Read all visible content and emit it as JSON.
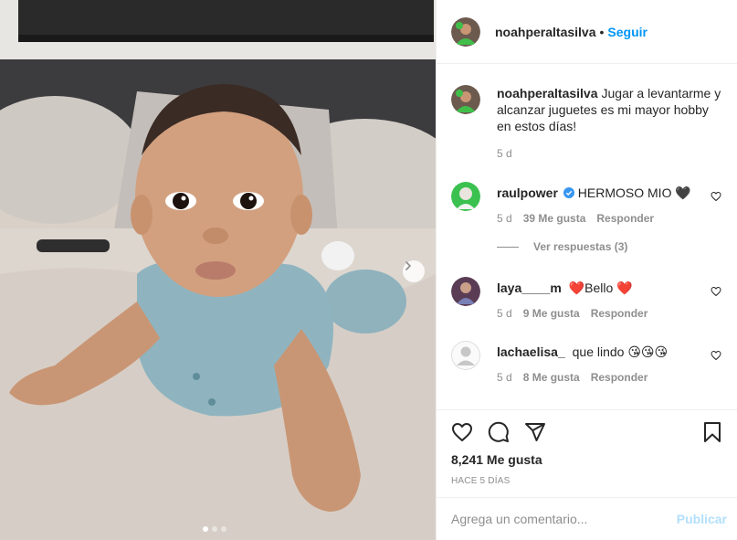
{
  "post": {
    "image_alt": "Baby lying on bed",
    "carousel_dots": 3,
    "active_dot": 0
  },
  "header": {
    "username": "noahperaltasilva",
    "separator": "•",
    "follow_label": "Seguir"
  },
  "caption": {
    "username": "noahperaltasilva",
    "text": "Jugar a levantarme y alcanzar juguetes es mi mayor hobby en estos días!",
    "time": "5 d"
  },
  "comments": [
    {
      "username": "raulpower",
      "verified": true,
      "text": "HERMOSO MIO 🖤",
      "time": "5 d",
      "likes": "39 Me gusta",
      "reply_label": "Responder",
      "view_replies": "Ver respuestas (3)"
    },
    {
      "username": "laya____m",
      "text": "❤️Bello ❤️",
      "time": "5 d",
      "likes": "9 Me gusta",
      "reply_label": "Responder"
    },
    {
      "username": "lachaelisa_",
      "text": "que lindo 😘😘😘",
      "time": "5 d",
      "likes": "8 Me gusta",
      "reply_label": "Responder"
    }
  ],
  "actions": {
    "likes_count": "8,241 Me gusta",
    "date": "HACE 5 DÍAS"
  },
  "add_comment": {
    "placeholder": "Agrega un comentario...",
    "publish_label": "Publicar"
  },
  "colors": {
    "link_blue": "#0095f6",
    "publish_disabled": "#b2dffc",
    "secondary_text": "#8e8e8e",
    "border": "#efefef"
  }
}
